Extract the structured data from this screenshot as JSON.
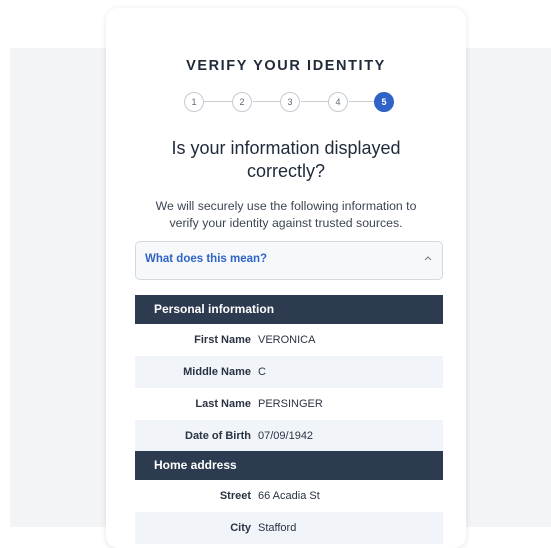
{
  "title": "VERIFY YOUR IDENTITY",
  "stepper": {
    "steps": [
      "1",
      "2",
      "3",
      "4",
      "5"
    ],
    "current": "5"
  },
  "heading": {
    "line1": "Is your information displayed",
    "line2": "correctly?"
  },
  "description": {
    "line1": "We will securely use the following information to",
    "line2": "verify your identity against trusted sources."
  },
  "accordion": {
    "label": "What does this mean?",
    "icon": "chevron-up-icon"
  },
  "personal_information": {
    "header": "Personal information",
    "fields": [
      {
        "label": "First Name",
        "value": "VERONICA"
      },
      {
        "label": "Middle Name",
        "value": "C"
      },
      {
        "label": "Last Name",
        "value": "PERSINGER"
      },
      {
        "label": "Date of Birth",
        "value": "07/09/1942"
      }
    ]
  },
  "home_address": {
    "header": "Home address",
    "fields": [
      {
        "label": "Street",
        "value": "66 Acadia St"
      },
      {
        "label": "City",
        "value": "Stafford"
      }
    ]
  },
  "colors": {
    "accent": "#2f63c6",
    "section_header": "#2c3b50",
    "row_alt": "#f1f5fa"
  }
}
